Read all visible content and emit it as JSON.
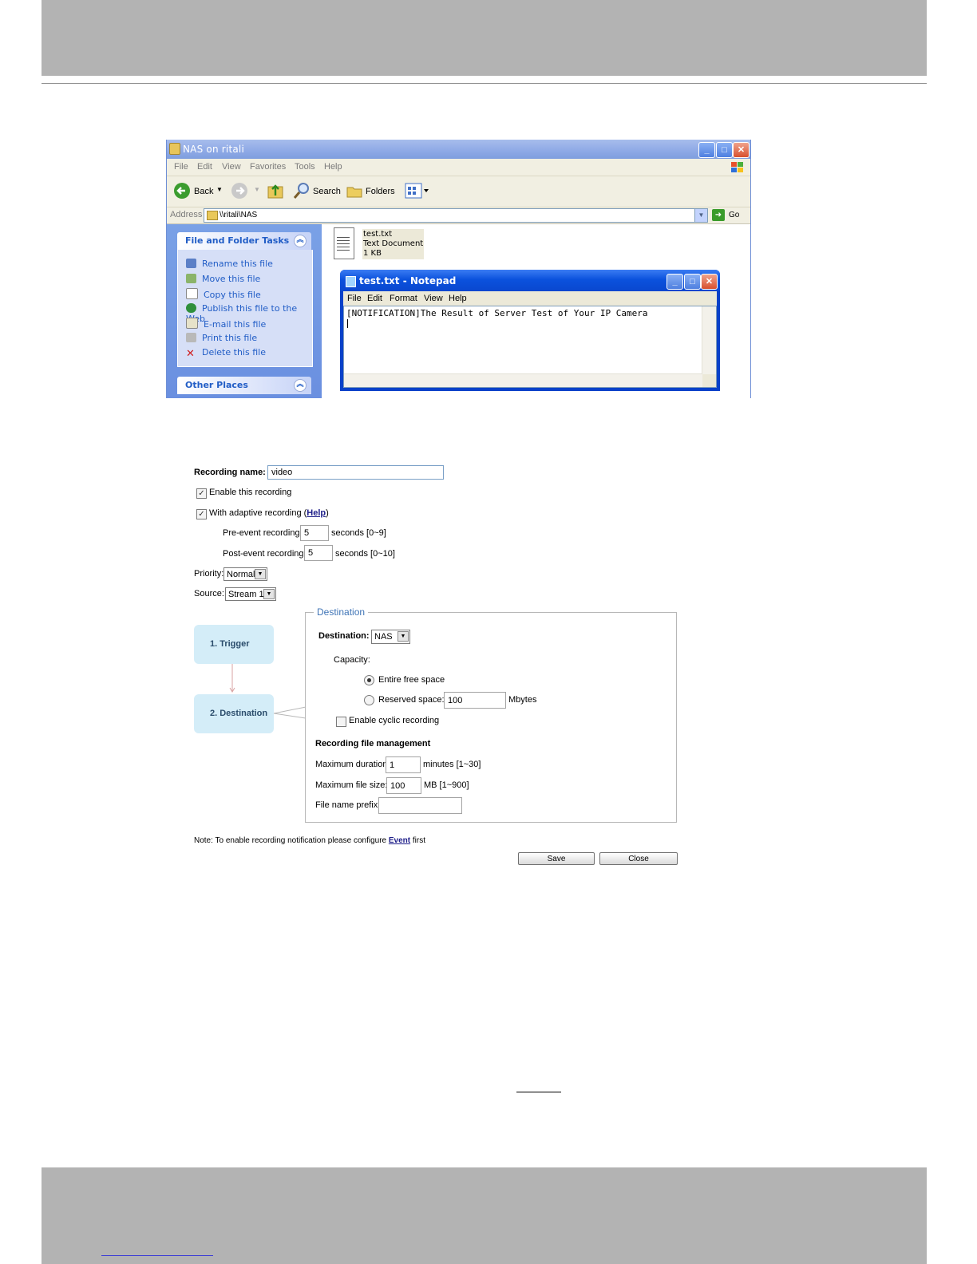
{
  "explorer": {
    "title": "NAS on ritali",
    "menu": [
      "File",
      "Edit",
      "View",
      "Favorites",
      "Tools",
      "Help"
    ],
    "toolbar": {
      "back": "Back",
      "search": "Search",
      "folders": "Folders"
    },
    "address_label": "Address",
    "address_value": "\\\\ritali\\NAS",
    "go": "Go",
    "tasks_title": "File and Folder Tasks",
    "tasks": [
      "Rename this file",
      "Move this file",
      "Copy this file",
      "Publish this file to the Web",
      "E-mail this file",
      "Print this file",
      "Delete this file"
    ],
    "other_places": "Other Places",
    "file": {
      "name": "test.txt",
      "type": "Text Document",
      "size": "1 KB"
    }
  },
  "notepad": {
    "title": "test.txt - Notepad",
    "menu": [
      "File",
      "Edit",
      "Format",
      "View",
      "Help"
    ],
    "content": "[NOTIFICATION]The Result of Server Test of Your IP Camera"
  },
  "recording": {
    "name_label": "Recording name:",
    "name_value": "video",
    "enable_label": "Enable this recording",
    "adaptive_label": "With adaptive recording (",
    "adaptive_help": "Help",
    "adaptive_close": ")",
    "pre_label": "Pre-event recording:",
    "pre_value": "5",
    "pre_unit": "seconds [0~9]",
    "post_label": "Post-event recording:",
    "post_value": "5",
    "post_unit": "seconds [0~10]",
    "priority_label": "Priority:",
    "priority_value": "Normal",
    "source_label": "Source:",
    "source_value": "Stream 1",
    "step1": "1.  Trigger",
    "step2": "2.  Destination",
    "destination": {
      "legend": "Destination",
      "label": "Destination:",
      "value": "NAS",
      "capacity": "Capacity:",
      "entire": "Entire free space",
      "reserved": "Reserved space:",
      "reserved_value": "100",
      "reserved_unit": "Mbytes",
      "cyclic": "Enable cyclic recording",
      "mgmt_title": "Recording file management",
      "max_duration_label": "Maximum duration:",
      "max_duration_value": "1",
      "max_duration_unit": "minutes [1~30]",
      "max_size_label": "Maximum file size:",
      "max_size_value": "100",
      "max_size_unit": "MB [1~900]",
      "prefix_label": "File name prefix:",
      "prefix_value": ""
    },
    "note_prefix": "Note: To enable recording notification please configure ",
    "note_link": "Event",
    "note_suffix": " first",
    "save": "Save",
    "close": "Close"
  }
}
